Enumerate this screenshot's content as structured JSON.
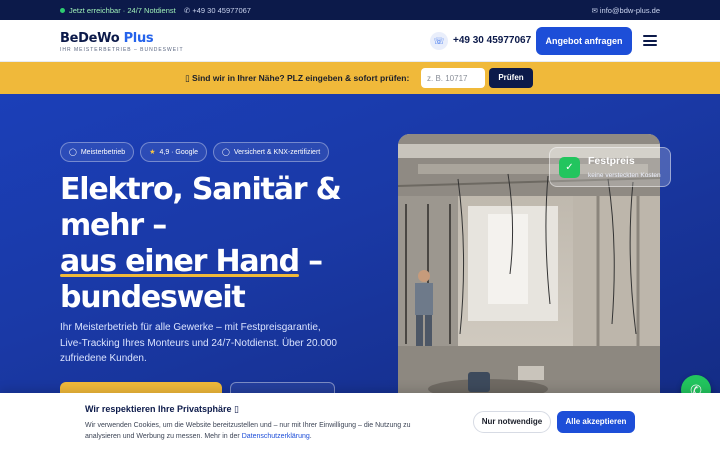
{
  "topbar": {
    "availability": "Jetzt erreichbar · 24/7 Notdienst",
    "phone": "✆ +49 30 45977067",
    "email": "✉ info@bdw-plus.de"
  },
  "header": {
    "logo_main": "BeDeWo",
    "logo_plus": "Plus",
    "logo_tagline": "IHR MEISTERBETRIEB – BUNDESWEIT",
    "phone": "+49 30 45977067",
    "cta_label": "Angebot anfragen"
  },
  "plz": {
    "prompt": "▯ Sind wir in Ihrer Nähe? PLZ eingeben & sofort prüfen:",
    "placeholder": "z. B. 10717",
    "button_label": "Prüfen"
  },
  "hero": {
    "badges": [
      {
        "icon": "medal-icon",
        "label": "Meisterbetrieb"
      },
      {
        "icon": "star-icon",
        "label": "4,9 · Google"
      },
      {
        "icon": "shield-icon",
        "label": "Versichert & KNX-zertifiziert"
      }
    ],
    "headline_1": "Elektro, Sanitär & mehr –",
    "headline_highlight": "aus einer Hand",
    "headline_2": " –",
    "headline_3": "bundesweit",
    "lead": "Ihr Meisterbetrieb für alle Gewerke – mit Festpreisgarantie, Live-Tracking Ihres Monteurs und 24/7-Notdienst. Über 20.000 zufriedene Kunden.",
    "accent_color": "#f0b93a"
  },
  "festpreis": {
    "title": "Festpreis",
    "subtitle": "keine versteckten Kosten"
  },
  "cookie": {
    "title": "Wir respektieren Ihre Privatsphäre ▯",
    "text": "Wir verwenden Cookies, um die Website bereitzustellen und – nur mit Ihrer Einwilligung – die Nutzung zu analysieren und Werbung zu messen. Mehr in der ",
    "link": "Datenschutzerklärung",
    "text_end": ".",
    "necessary_label": "Nur notwendige",
    "accept_label": "Alle akzeptieren"
  },
  "colors": {
    "navy": "#0c1a4a",
    "blue": "#1d4ed8",
    "yellow": "#f0b93a",
    "green": "#22c55e"
  }
}
